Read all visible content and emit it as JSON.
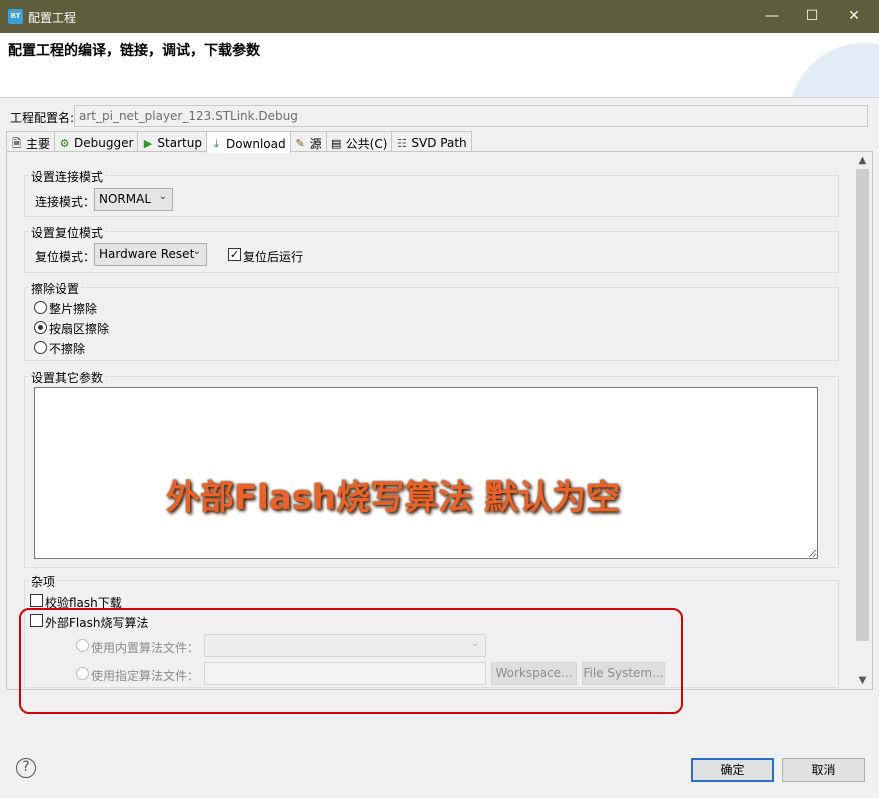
{
  "window": {
    "title": "配置工程",
    "minimize": "—",
    "maximize": "☐",
    "close": "✕"
  },
  "banner": {
    "heading": "配置工程的编译，链接，调试，下载参数"
  },
  "config": {
    "label": "工程配置名:",
    "value": "art_pi_net_player_123.STLink.Debug"
  },
  "tabs": [
    {
      "label": "主要",
      "icon": "document-icon"
    },
    {
      "label": "Debugger",
      "icon": "bug-icon"
    },
    {
      "label": "Startup",
      "icon": "play-icon"
    },
    {
      "label": "Download",
      "icon": "download-icon"
    },
    {
      "label": "源",
      "icon": "source-icon"
    },
    {
      "label": "公共(C)",
      "icon": "common-icon"
    },
    {
      "label": "SVD Path",
      "icon": "svd-icon"
    }
  ],
  "connection": {
    "group": "设置连接模式",
    "label": "连接模式：",
    "value": "NORMAL"
  },
  "reset": {
    "group": "设置复位模式",
    "label": "复位模式：",
    "value": "Hardware Reset",
    "run_after_reset": "复位后运行",
    "run_after_reset_checked": true
  },
  "erase": {
    "group": "擦除设置",
    "options": [
      "整片擦除",
      "按扇区擦除",
      "不擦除"
    ],
    "selected_index": 1
  },
  "other": {
    "group": "设置其它参数",
    "annotation": "外部Flash烧写算法 默认为空"
  },
  "misc": {
    "group": "杂项",
    "verify_flash": "校验flash下载",
    "external_flash": "外部Flash烧写算法",
    "builtin_algo": "使用内置算法文件：",
    "custom_algo": "使用指定算法文件：",
    "workspace_btn": "Workspace...",
    "filesystem_btn": "File System..."
  },
  "footer": {
    "help": "?",
    "ok": "确定",
    "cancel": "取消"
  },
  "colors": {
    "titlebar": "#5e5d3c",
    "annotation": "#e8632a",
    "outline": "#d40000",
    "default_button_border": "#2b6fc7"
  }
}
